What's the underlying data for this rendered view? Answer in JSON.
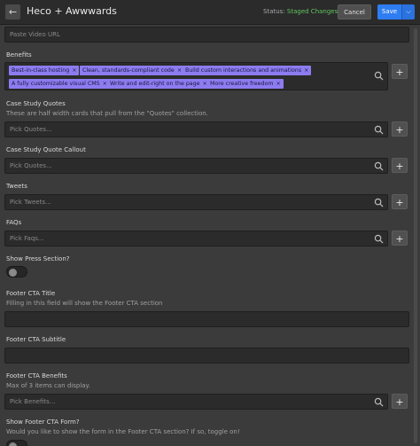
{
  "header": {
    "title": "Heco + Awwwards",
    "status_label": "Status:",
    "status_value": "Staged Changes",
    "cancel_label": "Cancel",
    "save_label": "Save",
    "back_icon": "arrow-left-icon",
    "caret_icon": "chevron-down-icon"
  },
  "video": {
    "placeholder": "Paste Video URL"
  },
  "benefits": {
    "label": "Benefits",
    "tags": [
      "Best-in-class hosting",
      "Clean, standards-compliant code",
      "Build custom interactions and animations",
      "A fully customizable visual CMS",
      "Write and edit-right on the page",
      "More creative freedom"
    ]
  },
  "case_study_quotes": {
    "label": "Case Study Quotes",
    "help": "These are half width cards that pull from the \"Quotes\" collection.",
    "placeholder": "Pick Quotes..."
  },
  "case_study_quote_callout": {
    "label": "Case Study Quote Callout",
    "placeholder": "Pick Quotes..."
  },
  "tweets": {
    "label": "Tweets",
    "placeholder": "Pick Tweets..."
  },
  "faqs": {
    "label": "FAQs",
    "placeholder": "Pick Faqs..."
  },
  "press": {
    "label": "Show Press Section?"
  },
  "footer_cta_title": {
    "label": "Footer CTA Title",
    "help": "Filling in this field will show the Footer CTA section"
  },
  "footer_cta_subtitle": {
    "label": "Footer CTA Subtitle"
  },
  "footer_cta_benefits": {
    "label": "Footer CTA Benefits",
    "help": "Max of 3 items can display.",
    "placeholder": "Pick Benefits..."
  },
  "footer_cta_form": {
    "label": "Show Footer CTA Form?",
    "help": "Would you like to show the form in the Footer CTA section? If so, toggle on!"
  },
  "plus_label": "+",
  "tag_remove": "×",
  "colors": {
    "accent": "#2e7df2",
    "tag": "#8c7cf0",
    "status": "#5fc55f"
  }
}
